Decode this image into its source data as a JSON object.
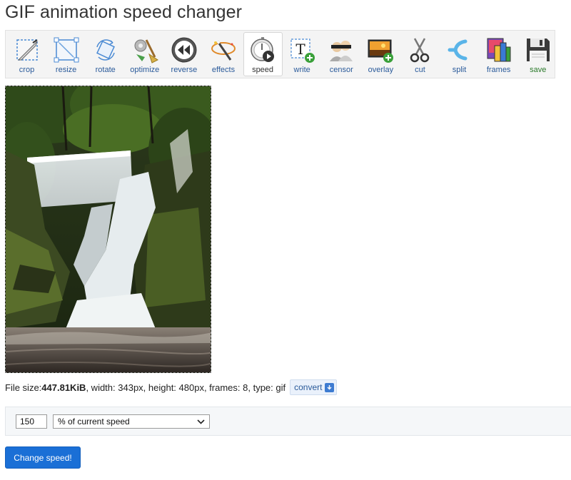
{
  "page": {
    "title": "GIF animation speed changer"
  },
  "toolbar": {
    "items": [
      {
        "label": "crop",
        "icon": "crop-icon"
      },
      {
        "label": "resize",
        "icon": "resize-icon"
      },
      {
        "label": "rotate",
        "icon": "rotate-icon"
      },
      {
        "label": "optimize",
        "icon": "optimize-broom-icon"
      },
      {
        "label": "reverse",
        "icon": "rewind-icon"
      },
      {
        "label": "effects",
        "icon": "magic-wand-icon"
      },
      {
        "label": "speed",
        "icon": "stopwatch-icon",
        "active": true
      },
      {
        "label": "write",
        "icon": "text-add-icon"
      },
      {
        "label": "censor",
        "icon": "censor-faces-icon"
      },
      {
        "label": "overlay",
        "icon": "image-overlay-icon"
      },
      {
        "label": "cut",
        "icon": "scissors-icon"
      },
      {
        "label": "split",
        "icon": "split-icon"
      },
      {
        "label": "frames",
        "icon": "frames-icon"
      },
      {
        "label": "save",
        "icon": "floppy-disk-icon"
      }
    ]
  },
  "file_info": {
    "size_prefix": "File size: ",
    "size": "447.81KiB",
    "details": ", width: 343px, height: 480px, frames: 8, type: gif",
    "convert_label": "convert"
  },
  "speed_form": {
    "value": "150",
    "mode": "% of current speed",
    "submit_label": "Change speed!"
  },
  "colors": {
    "primary_button": "#1a6fd6",
    "link": "#2a5a9a",
    "save_label": "#2b7a2b"
  }
}
